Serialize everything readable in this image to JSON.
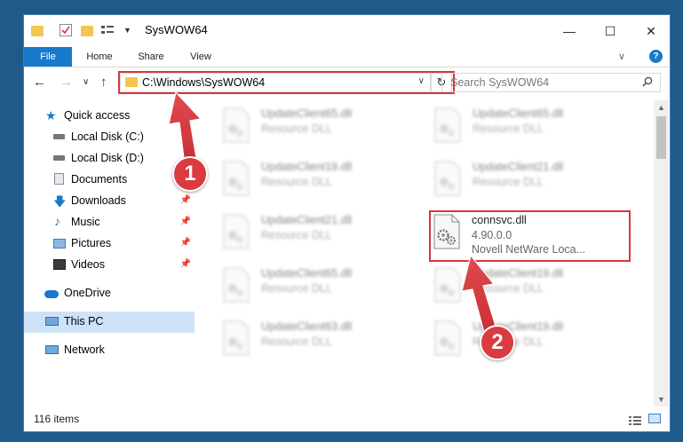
{
  "window": {
    "title": "SysWOW64"
  },
  "window_controls": {
    "minimize": "—",
    "maximize": "☐",
    "close": "✕"
  },
  "ribbon": {
    "tabs": [
      "File",
      "Home",
      "Share",
      "View"
    ],
    "toggle": "∨",
    "help": "?"
  },
  "nav": {
    "back": "←",
    "forward": "→",
    "recent": "∨",
    "up": "↑"
  },
  "address": {
    "path": "C:\\Windows\\SysWOW64",
    "dropdown": "∨",
    "refresh": "↻"
  },
  "search": {
    "placeholder": "Search SysWOW64",
    "icon": "search-icon"
  },
  "sidebar": {
    "items": [
      {
        "label": "Quick access",
        "icon": "star-icon",
        "pinned": false
      },
      {
        "label": "Local Disk (C:)",
        "icon": "drive-icon",
        "pinned": false
      },
      {
        "label": "Local Disk (D:)",
        "icon": "drive-icon",
        "pinned": false
      },
      {
        "label": "Documents",
        "icon": "documents-icon",
        "pinned": true
      },
      {
        "label": "Downloads",
        "icon": "downloads-icon",
        "pinned": true
      },
      {
        "label": "Music",
        "icon": "music-icon",
        "pinned": true
      },
      {
        "label": "Pictures",
        "icon": "pictures-icon",
        "pinned": true
      },
      {
        "label": "Videos",
        "icon": "videos-icon",
        "pinned": true
      },
      {
        "label": "OneDrive",
        "icon": "onedrive-icon",
        "pinned": false
      },
      {
        "label": "This PC",
        "icon": "computer-icon",
        "pinned": false,
        "selected": true
      },
      {
        "label": "Network",
        "icon": "network-icon",
        "pinned": false
      }
    ]
  },
  "files": [
    {
      "name": "UpdateClient65.dll",
      "line2": "Resource DLL",
      "line3": "",
      "blurred": true
    },
    {
      "name": "UpdateClient65.dll",
      "line2": "Resource DLL",
      "line3": "",
      "blurred": true
    },
    {
      "name": "UpdateClient19.dll",
      "line2": "Resource DLL",
      "line3": "",
      "blurred": true
    },
    {
      "name": "UpdateClient21.dll",
      "line2": "Resource DLL",
      "line3": "",
      "blurred": true
    },
    {
      "name": "UpdateClient21.dll",
      "line2": "Resource DLL",
      "line3": "",
      "blurred": true
    },
    {
      "name": "connsvc.dll",
      "line2": "4.90.0.0",
      "line3": "Novell NetWare Loca...",
      "blurred": false
    },
    {
      "name": "UpdateClient65.dll",
      "line2": "Resource DLL",
      "line3": "",
      "blurred": true
    },
    {
      "name": "UpdateClient19.dll",
      "line2": "Resource DLL",
      "line3": "",
      "blurred": true
    },
    {
      "name": "UpdateClient63.dll",
      "line2": "Resource DLL",
      "line3": "",
      "blurred": true
    },
    {
      "name": "UpdateClient19.dll",
      "line2": "Resource DLL",
      "line3": "",
      "blurred": true
    }
  ],
  "status": {
    "item_count": "116 items"
  },
  "annotations": {
    "step1": "1",
    "step2": "2",
    "color": "#d93b40"
  },
  "colors": {
    "accent": "#1979ca",
    "selection": "#cde2f6",
    "highlight": "#d9363e"
  }
}
